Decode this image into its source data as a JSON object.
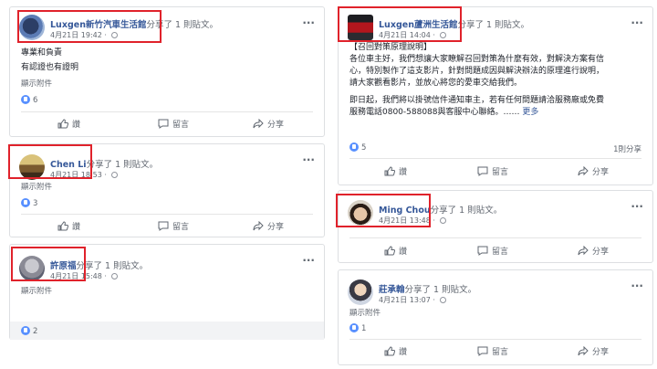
{
  "posts": [
    {
      "name": "Luxgen新竹汽車生活館",
      "shared": "分享了 1 則貼文。",
      "time": "4月21日 19:42",
      "lines": [
        "專業和負責",
        "有認證也有證明"
      ],
      "attachment": "顯示附件",
      "likes": "6",
      "actions": {
        "like": "讚",
        "comment": "留言",
        "share": "分享"
      }
    },
    {
      "name": "Chen Li",
      "shared": "分享了 1 則貼文。",
      "time": "4月21日 18:53",
      "attachment": "顯示附件",
      "likes": "3",
      "actions": {
        "like": "讚",
        "comment": "留言",
        "share": "分享"
      }
    },
    {
      "name": "許原福",
      "shared": "分享了 1 則貼文。",
      "time": "4月21日 15:48",
      "attachment": "顯示附件",
      "likes": "2"
    },
    {
      "name": "Luxgen蘆洲生活館",
      "shared": "分享了 1 則貼文。",
      "time": "4月21日 14:04",
      "lines": [
        "【召回對策原理說明】",
        "各位車主好，我們想讓大家瞭解召回對策為什麼有效，對解決方案有信",
        "心，特別製作了這支影片，針對問題成因與解決辦法的原理進行說明，",
        "請大家觀看影片，並放心將您的愛車交給我們。"
      ],
      "para2": [
        "即日起，我們將以掛號信件通知車主，若有任何問題請洽服務廠或免費",
        "服務電話0800-588088與客服中心聯絡。……"
      ],
      "more": "更多",
      "likes": "5",
      "comments": "1則分享",
      "actions": {
        "like": "讚",
        "comment": "留言",
        "share": "分享"
      }
    },
    {
      "name": "Ming Chou",
      "shared": "分享了 1 則貼文。",
      "time": "4月21日 13:48",
      "actions": {
        "like": "讚",
        "comment": "留言",
        "share": "分享"
      }
    },
    {
      "name": "莊承翰",
      "shared": "分享了 1 則貼文。",
      "time": "4月21日 13:07",
      "attachment": "顯示附件",
      "likes": "1",
      "actions": {
        "like": "讚",
        "comment": "留言",
        "share": "分享"
      }
    }
  ],
  "colors": {
    "highlight": "#e0222b",
    "link": "#365899",
    "like": "#5890ff"
  },
  "icons": [
    "like-icon",
    "comment-icon",
    "share-icon",
    "globe-icon",
    "more-options-icon"
  ]
}
